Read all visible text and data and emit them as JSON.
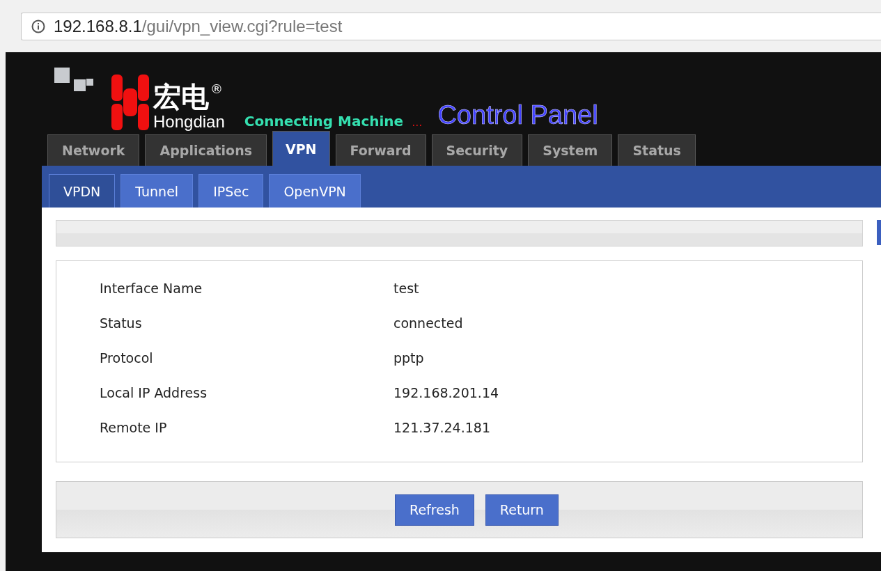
{
  "address_bar": {
    "host": "192.168.8.1",
    "path": "/gui/vpn_view.cgi?rule=test"
  },
  "header": {
    "brand_cn": "宏电",
    "registered": "®",
    "brand_en": "Hongdian",
    "tagline": "Connecting Machine",
    "ellipsis": "...",
    "title": "Control Panel"
  },
  "main_tabs": [
    {
      "label": "Network",
      "selected": false
    },
    {
      "label": "Applications",
      "selected": false
    },
    {
      "label": "VPN",
      "selected": true
    },
    {
      "label": "Forward",
      "selected": false
    },
    {
      "label": "Security",
      "selected": false
    },
    {
      "label": "System",
      "selected": false
    },
    {
      "label": "Status",
      "selected": false
    }
  ],
  "sub_tabs": [
    {
      "label": "VPDN",
      "selected": true
    },
    {
      "label": "Tunnel",
      "selected": false
    },
    {
      "label": "IPSec",
      "selected": false
    },
    {
      "label": "OpenVPN",
      "selected": false
    }
  ],
  "details": [
    {
      "label": "Interface Name",
      "value": "test"
    },
    {
      "label": "Status",
      "value": "connected"
    },
    {
      "label": "Protocol",
      "value": "pptp"
    },
    {
      "label": "Local IP Address",
      "value": "192.168.201.14"
    },
    {
      "label": "Remote IP",
      "value": "121.37.24.181"
    }
  ],
  "buttons": [
    "Refresh",
    "Return"
  ]
}
